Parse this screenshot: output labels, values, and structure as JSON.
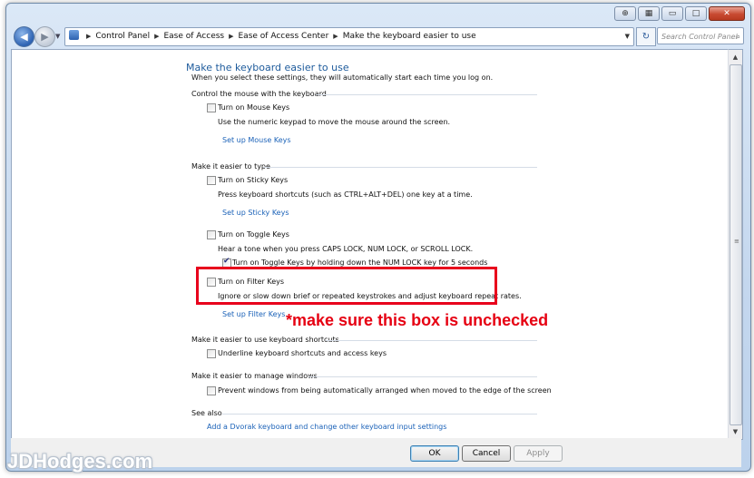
{
  "titlebar": {
    "buttons": [
      "help-icon",
      "keyboard-icon",
      "minimize-icon",
      "maximize-icon",
      "close-icon"
    ]
  },
  "nav": {
    "breadcrumb": [
      "Control Panel",
      "Ease of Access",
      "Ease of Access Center",
      "Make the keyboard easier to use"
    ],
    "search_placeholder": "Search Control Panel"
  },
  "main": {
    "title": "Make the keyboard easier to use",
    "subtitle": "When you select these settings, they will automatically start each time you log on.",
    "sections": {
      "mouse": {
        "heading": "Control the mouse with the keyboard",
        "mouse_keys": {
          "label": "Turn on Mouse Keys",
          "checked": false
        },
        "mouse_keys_desc": "Use the numeric keypad to move the mouse around the screen.",
        "mouse_keys_link": "Set up Mouse Keys"
      },
      "type": {
        "heading": "Make it easier to type",
        "sticky_keys": {
          "label": "Turn on Sticky Keys",
          "checked": false
        },
        "sticky_keys_desc": "Press keyboard shortcuts (such as CTRL+ALT+DEL) one key at a time.",
        "sticky_keys_link": "Set up Sticky Keys",
        "toggle_keys": {
          "label": "Turn on Toggle Keys",
          "checked": false
        },
        "toggle_keys_desc": "Hear a tone when you press CAPS LOCK, NUM LOCK, or SCROLL LOCK.",
        "toggle_keys_hold": {
          "label": "Turn on Toggle Keys by holding down the NUM LOCK key for 5 seconds",
          "checked": true
        },
        "filter_keys": {
          "label": "Turn on Filter Keys",
          "checked": false
        },
        "filter_keys_desc": "Ignore or slow down brief or repeated keystrokes and adjust keyboard repeat rates.",
        "filter_keys_link": "Set up Filter Keys"
      },
      "shortcuts": {
        "heading": "Make it easier to use keyboard shortcuts",
        "underline": {
          "label": "Underline keyboard shortcuts and access keys",
          "checked": false
        }
      },
      "windows": {
        "heading": "Make it easier to manage windows",
        "prevent_arrange": {
          "label": "Prevent windows from being automatically arranged when moved to the edge of the screen",
          "checked": false
        }
      },
      "see_also": {
        "heading": "See also",
        "dvorak_link": "Add a Dvorak keyboard and change other keyboard input settings"
      }
    }
  },
  "footer": {
    "ok": "OK",
    "cancel": "Cancel",
    "apply": "Apply"
  },
  "annotation": {
    "text": "*make sure this box is unchecked",
    "color": "#e60012"
  },
  "watermark": {
    "text": "JDHodges.com"
  },
  "colors": {
    "accent_link": "#1b62b8",
    "title": "#1e5b9c"
  }
}
